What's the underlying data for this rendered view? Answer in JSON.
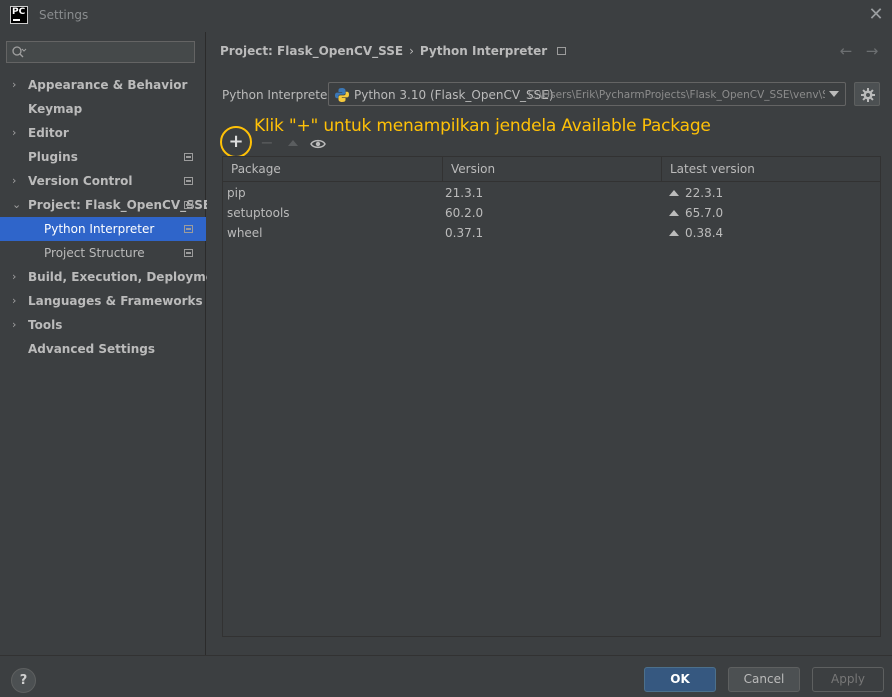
{
  "window": {
    "title": "Settings",
    "logo_text": "PC",
    "close_glyph": "✕"
  },
  "sidebar": {
    "search": {
      "placeholder": "",
      "value": ""
    },
    "items": [
      {
        "label": "Appearance & Behavior",
        "chevron": "›",
        "project_icon": false
      },
      {
        "label": "Keymap",
        "chevron": "",
        "project_icon": false
      },
      {
        "label": "Editor",
        "chevron": "›",
        "project_icon": false
      },
      {
        "label": "Plugins",
        "chevron": "",
        "project_icon": true
      },
      {
        "label": "Version Control",
        "chevron": "›",
        "project_icon": true
      },
      {
        "label": "Project: Flask_OpenCV_SSE",
        "chevron": "⌄",
        "project_icon": true
      },
      {
        "label": "Python Interpreter",
        "chevron": "",
        "project_icon": true,
        "selected": true,
        "child": true
      },
      {
        "label": "Project Structure",
        "chevron": "",
        "project_icon": true,
        "child": true
      },
      {
        "label": "Build, Execution, Deployment",
        "chevron": "›",
        "project_icon": false
      },
      {
        "label": "Languages & Frameworks",
        "chevron": "›",
        "project_icon": false
      },
      {
        "label": "Tools",
        "chevron": "›",
        "project_icon": false
      },
      {
        "label": "Advanced Settings",
        "chevron": "",
        "project_icon": false
      }
    ]
  },
  "breadcrumb": {
    "project": "Project: Flask_OpenCV_SSE",
    "separator": "›",
    "page": "Python Interpreter"
  },
  "nav": {
    "back_glyph": "←",
    "forward_glyph": "→"
  },
  "interpreter": {
    "label": "Python Interpreter:",
    "name": "Python 3.10 (Flask_OpenCV_SSE)",
    "path": "C:\\Users\\Erik\\PycharmProjects\\Flask_OpenCV_SSE\\venv\\Sc"
  },
  "annotation": "Klik \"+\" untuk menampilkan jendela Available Package",
  "toolbar": {
    "add_glyph": "+",
    "remove_glyph": "−"
  },
  "table": {
    "headers": [
      "Package",
      "Version",
      "Latest version"
    ],
    "rows": [
      {
        "package": "pip",
        "version": "21.3.1",
        "latest": "22.3.1"
      },
      {
        "package": "setuptools",
        "version": "60.2.0",
        "latest": "65.7.0"
      },
      {
        "package": "wheel",
        "version": "0.37.1",
        "latest": "0.38.4"
      }
    ]
  },
  "footer": {
    "help": "?",
    "ok": "OK",
    "cancel": "Cancel",
    "apply": "Apply"
  },
  "colors": {
    "accent_selected": "#2f65ca",
    "annotation": "#ffc107",
    "ok_button": "#365880",
    "background": "#3c3f41"
  }
}
